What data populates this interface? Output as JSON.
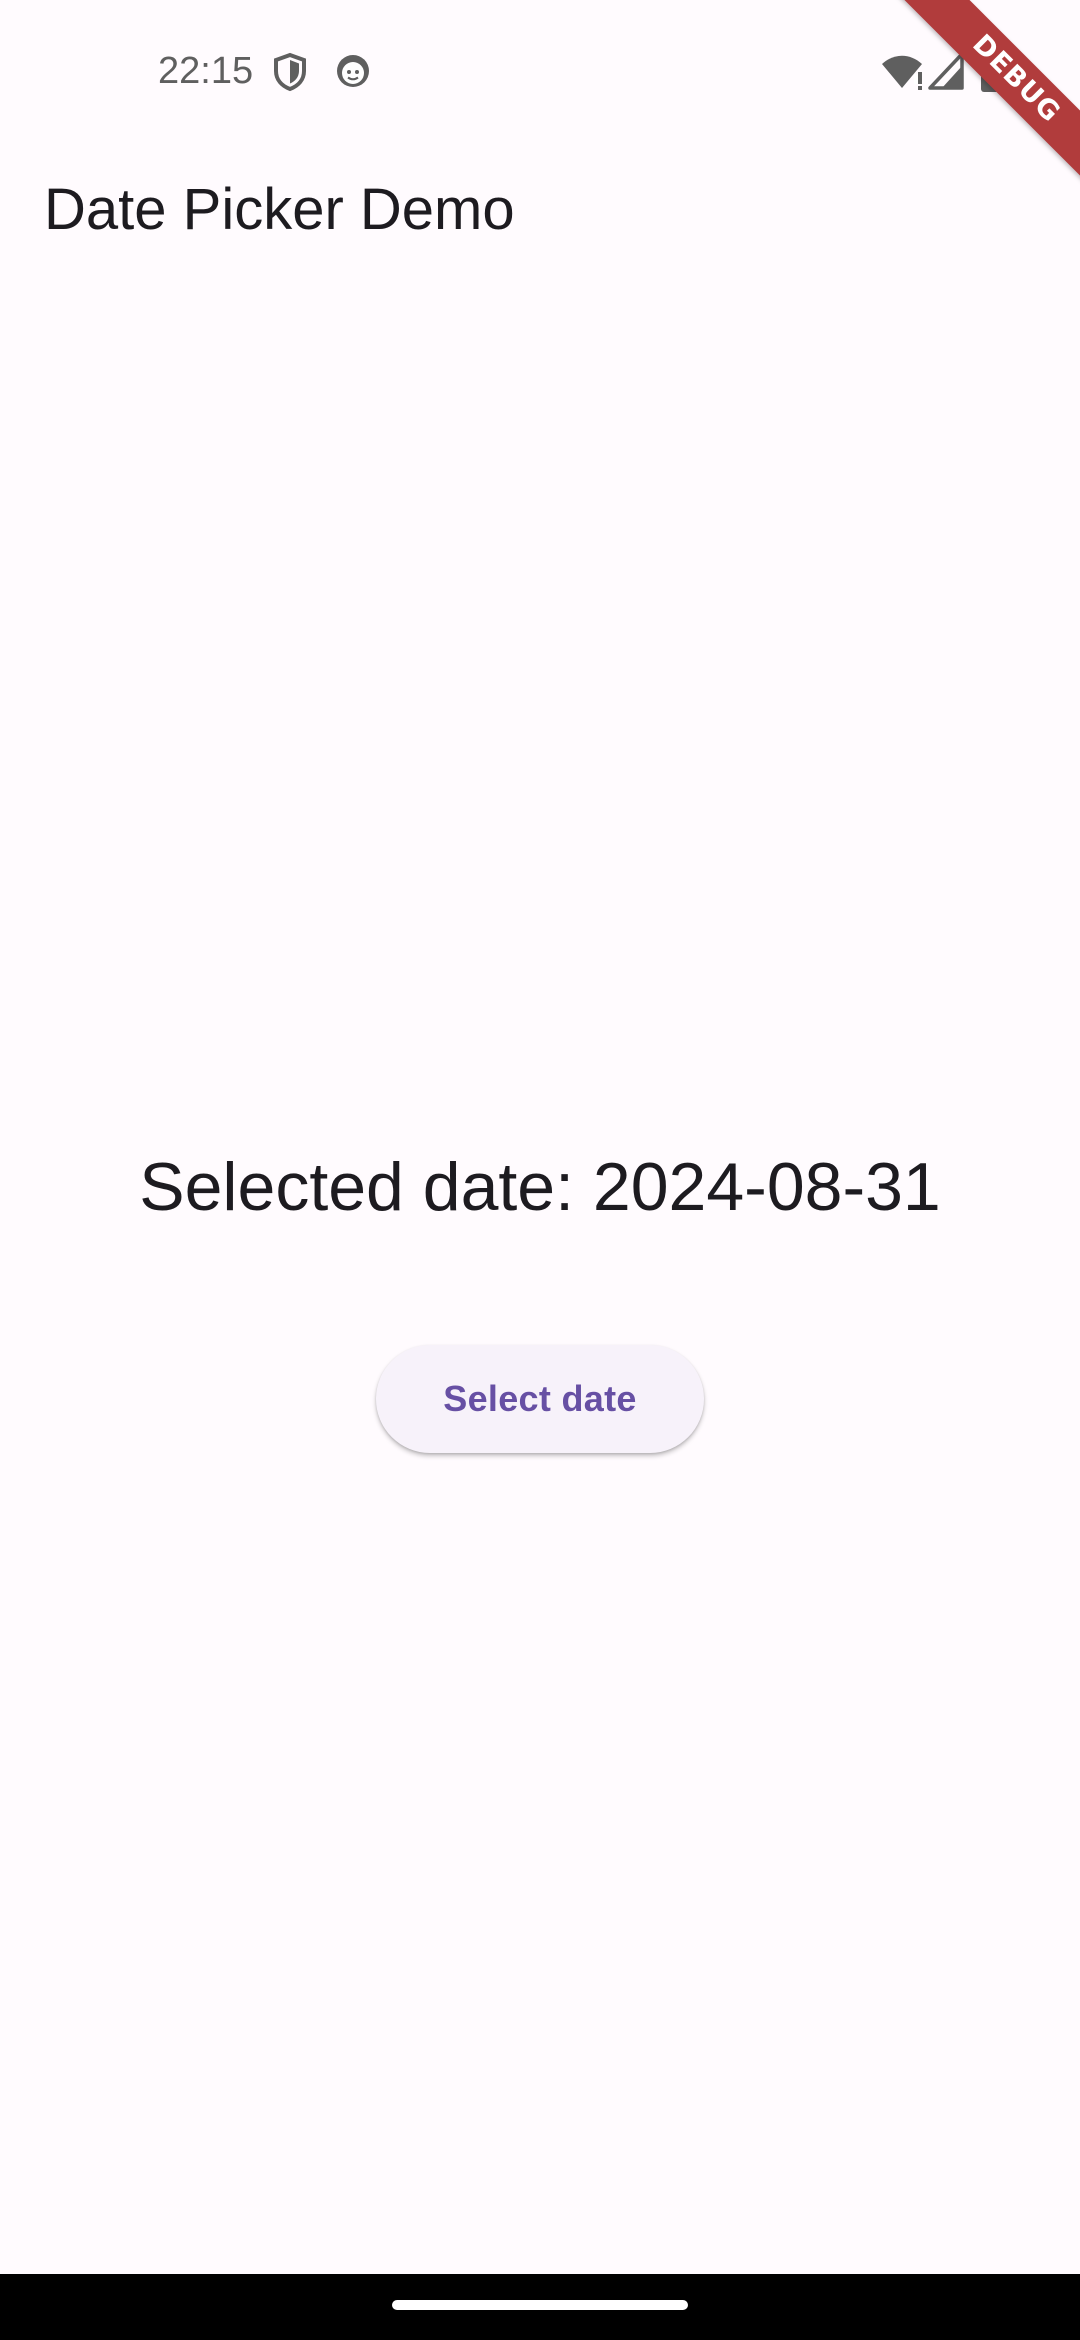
{
  "status_bar": {
    "time": "22:15",
    "left_icons": [
      "shield-icon",
      "face-icon"
    ],
    "right_icons": [
      "wifi-icon",
      "signal-icon",
      "battery-icon"
    ]
  },
  "app_bar": {
    "title": "Date Picker Demo"
  },
  "main": {
    "selected_date_text": "Selected date: 2024-08-31",
    "select_button_label": "Select date"
  },
  "debug_banner": {
    "label": "DEBUG"
  },
  "colors": {
    "background": "#fffbfe",
    "primary": "#6750a4",
    "button_surface": "#f7f2fa",
    "debug_banner": "#b13c3c"
  }
}
